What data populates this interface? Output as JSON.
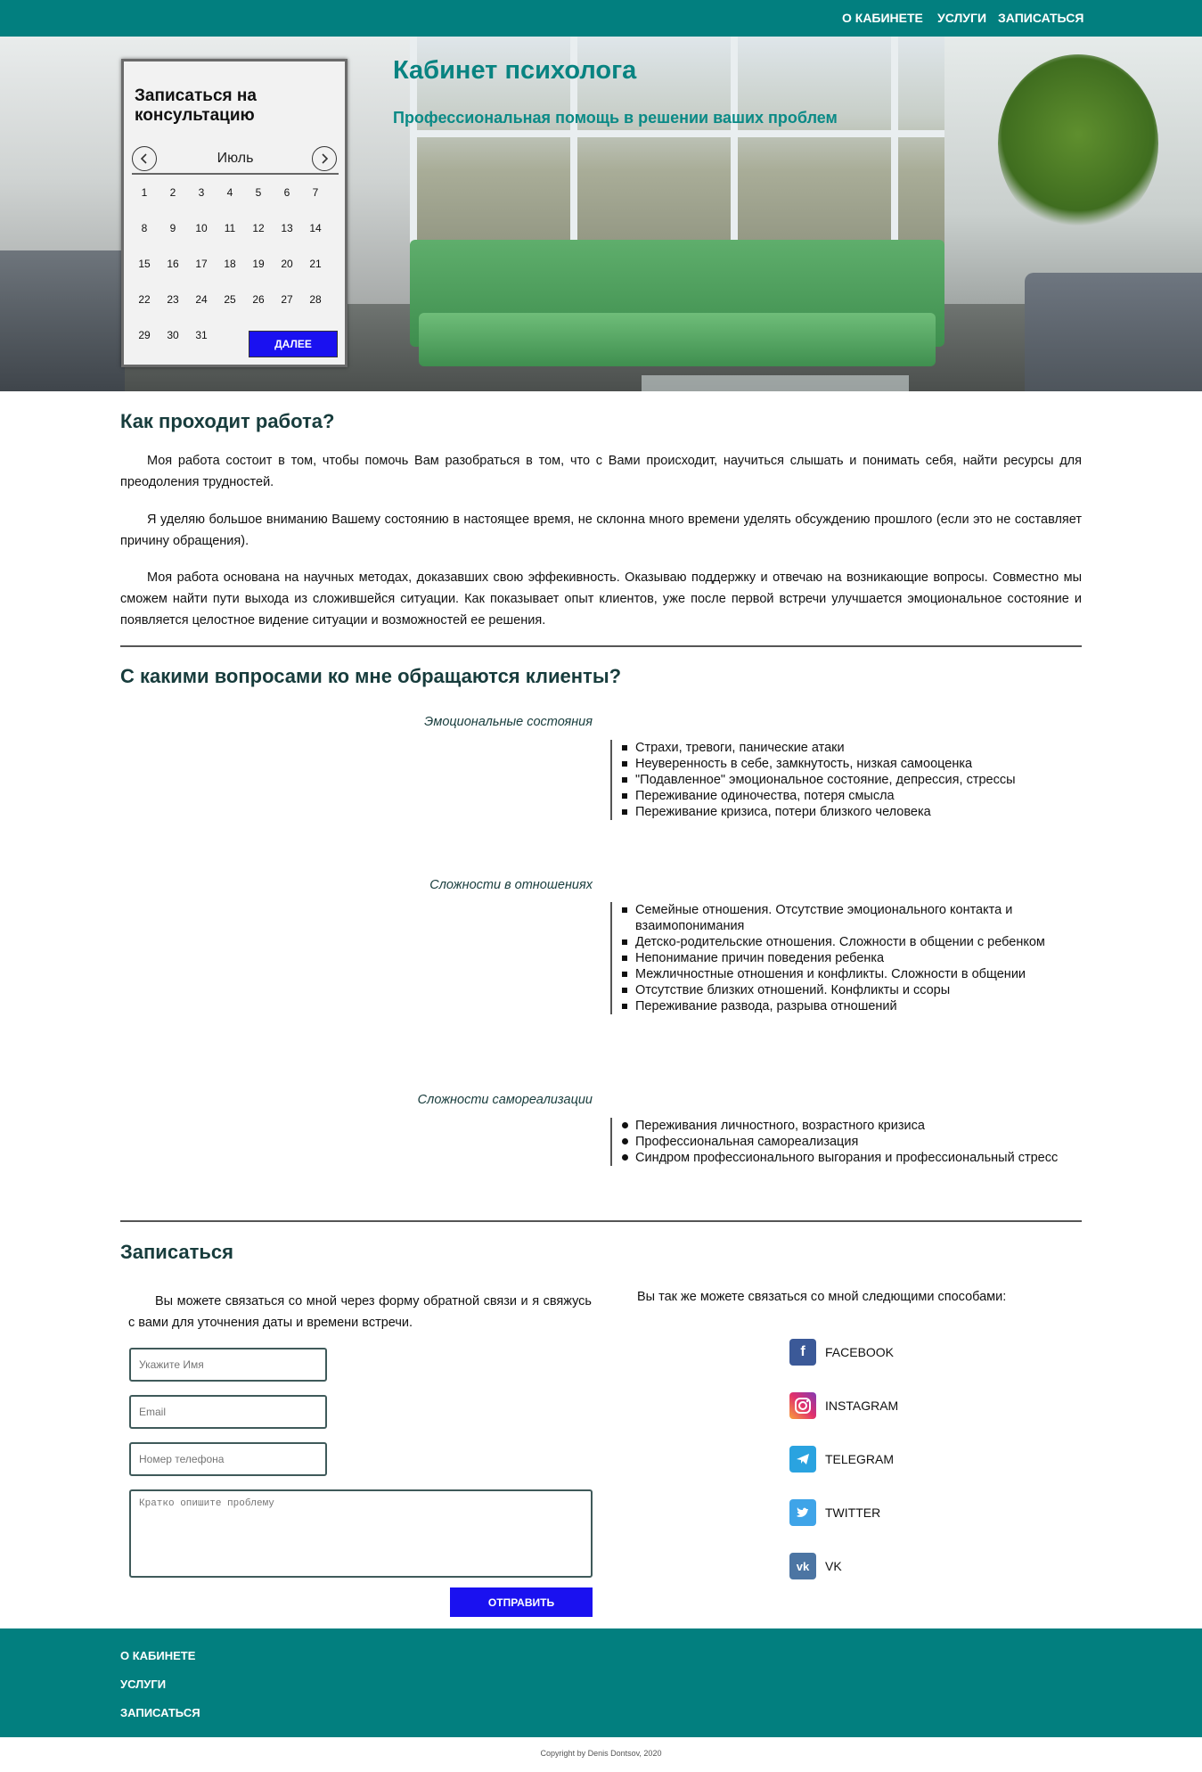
{
  "nav": {
    "about": "О КАБИНЕТЕ",
    "services": "УСЛУГИ",
    "signup": "ЗАПИСАТЬСЯ"
  },
  "hero": {
    "title": "Кабинет психолога",
    "subtitle": "Профессиональная помощь в решении ваших проблем"
  },
  "calendar": {
    "title": "Записаться на консультацию",
    "month": "Июль",
    "prev_icon": "chevron-left-icon",
    "next_icon": "chevron-right-icon",
    "days": [
      "1",
      "2",
      "3",
      "4",
      "5",
      "6",
      "7",
      "8",
      "9",
      "10",
      "11",
      "12",
      "13",
      "14",
      "15",
      "16",
      "17",
      "18",
      "19",
      "20",
      "21",
      "22",
      "23",
      "24",
      "25",
      "26",
      "27",
      "28",
      "29",
      "30",
      "31"
    ],
    "next_button": "ДАЛЕЕ"
  },
  "work": {
    "title": "Как проходит работа?",
    "p1": "Моя работа состоит в том, чтобы помочь Вам разобраться в том, что с Вами происходит, научиться слышать и понимать себя, найти ресурсы для преодоления трудностей.",
    "p2": "Я уделяю большое вниманию Вашему состоянию в настоящее время, не склонна много времени уделять обсуждению прошлого (если это не составляет причину обращения).",
    "p3": "Моя работа основана на научных методах, доказавших свою эффекивность. Оказываю поддержку и отвечаю на возникающие вопросы. Совместно мы сможем найти пути выхода из сложившейся ситуации. Как показывает опыт клиентов, уже после первой встречи улучшается эмоциональное состояние и появляется целостное видение ситуации и возможностей ее решения."
  },
  "issues": {
    "title": "С какими вопросами ко мне обращаются клиенты?",
    "categories": [
      {
        "label": "Эмоциональные состояния",
        "items": [
          "Страхи, тревоги, панические атаки",
          "Неуверенность в себе, замкнутость, низкая самооценка",
          "\"Подавленное\" эмоциональное состояние, депрессия, стрессы",
          "Переживание одиночества, потеря смысла",
          "Переживание кризиса, потери близкого человека"
        ]
      },
      {
        "label": "Сложности в отношениях",
        "items": [
          "Семейные отношения. Отсутствие эмоционального контакта и взаимопонимания",
          "Детско-родительские отношения. Сложности в общении с ребенком",
          "Непонимание причин поведения ребенка",
          "Межличностные отношения и конфликты. Сложности в общении",
          "Отсутствие близких отношений. Конфликты и ссоры",
          "Переживание развода, разрыва отношений"
        ]
      },
      {
        "label": "Сложности самореализации",
        "items": [
          "Переживания личностного, возрастного кризиса",
          "Профессиональная самореализация",
          "Синдром профессионального выгорания и профессиональный стресс"
        ]
      }
    ]
  },
  "contact": {
    "title": "Записаться",
    "intro": "Вы можете связаться со мной через форму обратной связи и я свяжусь с вами для уточнения даты и времени встречи.",
    "other_ways": "Вы так же можете связаться со мной следющими способами:",
    "name_placeholder": "Укажите Имя",
    "email_placeholder": "Email",
    "phone_placeholder": "Номер телефона",
    "problem_placeholder": "Кратко опишите проблему",
    "send_button": "ОТПРАВИТЬ",
    "socials": [
      {
        "label": "FACEBOOK",
        "icon": "facebook-icon",
        "color": "#3b5998"
      },
      {
        "label": "INSTAGRAM",
        "icon": "instagram-icon",
        "color": "#c13584"
      },
      {
        "label": "TELEGRAM",
        "icon": "telegram-icon",
        "color": "#2aa3e0"
      },
      {
        "label": "TWITTER",
        "icon": "twitter-icon",
        "color": "#3fa4e8"
      },
      {
        "label": "VK",
        "icon": "vk-icon",
        "color": "#4c75a3"
      }
    ]
  },
  "footer": {
    "about": "О КАБИНЕТЕ",
    "services": "УСЛУГИ",
    "signup": "ЗАПИСАТЬСЯ",
    "copyright": "Copyright by Denis Dontsov, 2020"
  },
  "colors": {
    "brand": "#027f7f",
    "accent_button": "#1a11f0",
    "heading": "#088381"
  }
}
